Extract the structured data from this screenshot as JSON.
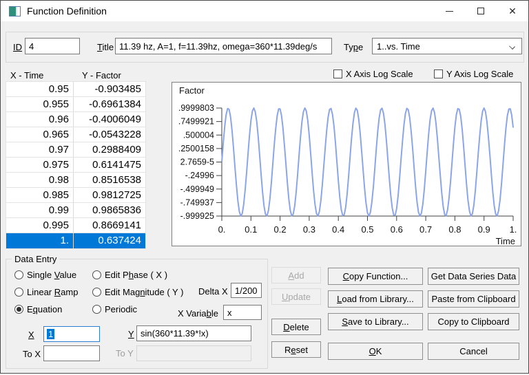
{
  "window": {
    "title": "Function Definition"
  },
  "icons": {
    "close": "✕"
  },
  "header": {
    "id_label": "ID",
    "id_value": "4",
    "title_label": "Title",
    "title_value": "11.39 hz, A=1, f=11.39hz, omega=360*11.39deg/s",
    "type_label": "Type",
    "type_value": "1..vs. Time"
  },
  "table": {
    "x_header": "X - Time",
    "y_header": "Y - Factor",
    "selected_index": 10,
    "rows": [
      [
        "0.95",
        "-0.903485"
      ],
      [
        "0.955",
        "-0.6961384"
      ],
      [
        "0.96",
        "-0.4006049"
      ],
      [
        "0.965",
        "-0.0543228"
      ],
      [
        "0.97",
        "0.2988409"
      ],
      [
        "0.975",
        "0.6141475"
      ],
      [
        "0.98",
        "0.8516538"
      ],
      [
        "0.985",
        "0.9812725"
      ],
      [
        "0.99",
        "0.9865836"
      ],
      [
        "0.995",
        "0.8669141"
      ],
      [
        "1.",
        "0.637424"
      ]
    ]
  },
  "log_scale": {
    "x_label": "X Axis Log Scale",
    "y_label": "Y Axis Log Scale",
    "x_checked": false,
    "y_checked": false
  },
  "chart_data": {
    "type": "line",
    "title": "",
    "ylabel": "Factor",
    "xlabel": "Time",
    "xlim": [
      0,
      1
    ],
    "ylim": [
      -0.999925,
      0.9999803
    ],
    "grid": false,
    "legend": "none",
    "x_tick_labels": [
      "0.",
      "0.1",
      "0.2",
      "0.3",
      "0.4",
      "0.5",
      "0.6",
      "0.7",
      "0.8",
      "0.9",
      "1."
    ],
    "y_tick_labels": [
      ".9999803",
      ".7499921",
      ".500004",
      ".2500158",
      "2.7659-5",
      "-.24996",
      "-.499949",
      "-.749937",
      "-.999925"
    ],
    "series": [
      {
        "name": "sin(360*11.39*!x)",
        "shape": "sine",
        "amplitude": 1,
        "cycles": 11.39,
        "phase_deg": 0,
        "samples": 201
      }
    ],
    "line_color": "#8ca4e8",
    "axis_color": "#404040"
  },
  "data_entry": {
    "group_label": "Data Entry",
    "radios": [
      {
        "label": "Single Value",
        "checked": false
      },
      {
        "label": "Linear Ramp",
        "checked": false
      },
      {
        "label": "Equation",
        "checked": true
      },
      {
        "label": "Edit Phase ( X )",
        "checked": false
      },
      {
        "label": "Edit Magnitude ( Y )",
        "checked": false
      },
      {
        "label": "Periodic",
        "checked": false
      }
    ],
    "delta_x_label": "Delta X",
    "delta_x_value": "1/200",
    "x_variable_label": "X Variable",
    "x_variable_value": "x",
    "x_label": "X",
    "x_value": "1",
    "y_label": "Y",
    "y_value": "sin(360*11.39*!x)",
    "to_x_label": "To X",
    "to_x_value": "",
    "to_y_label": "To Y",
    "to_y_value": ""
  },
  "buttons": {
    "add": "Add",
    "update": "Update",
    "delete": "Delete",
    "reset": "Reset",
    "copy_function": "Copy Function...",
    "get_data_series": "Get Data Series Data",
    "load_library": "Load from Library...",
    "paste_clipboard": "Paste from Clipboard",
    "save_library": "Save to Library...",
    "copy_clipboard": "Copy to Clipboard",
    "ok": "OK",
    "cancel": "Cancel"
  },
  "colors": {
    "selection": "#0078d7",
    "line": "#8ca4e8"
  }
}
